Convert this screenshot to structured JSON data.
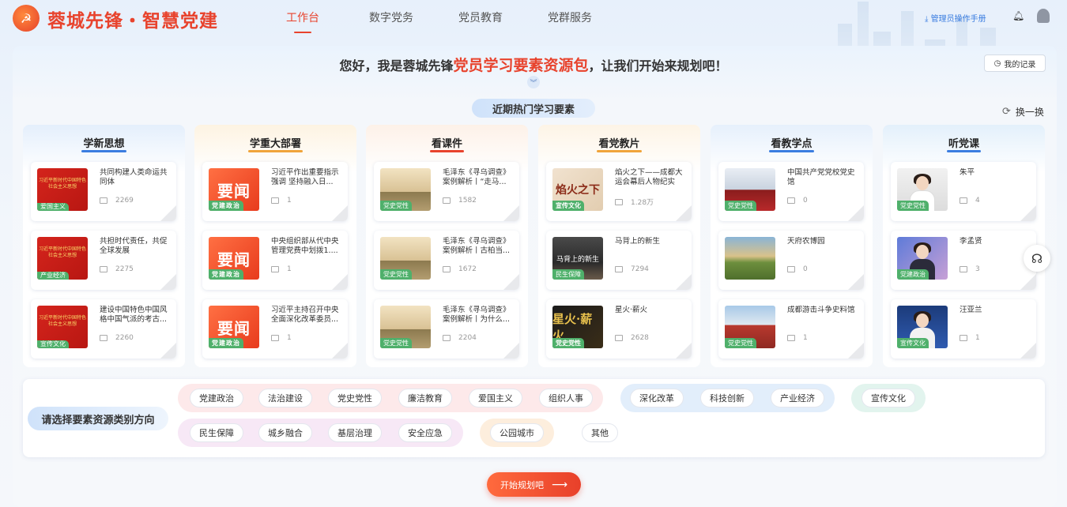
{
  "header": {
    "brand": "蓉城先锋・智慧党建",
    "nav": [
      "工作台",
      "数字党务",
      "党员教育",
      "党群服务"
    ],
    "active_nav": "工作台",
    "manual": "管理员操作手册"
  },
  "greeting": {
    "prefix": "您好，我是蓉城先锋",
    "highlight": "党员学习要素资源包",
    "suffix": "，让我们开始来规划吧！"
  },
  "records_label": "我的记录",
  "hot_title": "近期热门学习要素",
  "refresh_label": "换一换",
  "columns": [
    {
      "title": "学新思想",
      "accent": "#3b7de0",
      "items": [
        {
          "title": "共同构建人类命运共同体",
          "tag": "爱国主义",
          "views": "2269",
          "thumb": "习近平新时代中国特色社会主义思想"
        },
        {
          "title": "共担时代责任，共促全球发展",
          "tag": "产业经济",
          "views": "2275",
          "thumb": "习近平新时代中国特色社会主义思想"
        },
        {
          "title": "建设中国特色中国风格中国气派的考古...",
          "tag": "宣传文化",
          "views": "2260",
          "thumb": "习近平新时代中国特色社会主义思想"
        }
      ]
    },
    {
      "title": "学重大部署",
      "accent": "#f0a43a",
      "items": [
        {
          "title": "习近平作出重要指示强调 坚持融入日...",
          "tag": "党建政治",
          "views": "1",
          "thumb": "要闻"
        },
        {
          "title": "中央组织部从代中央管理党费中划拨1....",
          "tag": "党建政治",
          "views": "1",
          "thumb": "要闻"
        },
        {
          "title": "习近平主持召开中央全面深化改革委员...",
          "tag": "党建政治",
          "views": "1",
          "thumb": "要闻"
        }
      ]
    },
    {
      "title": "看课件",
      "accent": "#e8432d",
      "items": [
        {
          "title": "毛泽东《寻乌调查》案例解析丨“走马...",
          "tag": "党史党性",
          "views": "1582",
          "thumb": ""
        },
        {
          "title": "毛泽东《寻乌调查》案例解析丨古柏当...",
          "tag": "党史党性",
          "views": "1672",
          "thumb": ""
        },
        {
          "title": "毛泽东《寻乌调查》案例解析丨为什么...",
          "tag": "党史党性",
          "views": "2204",
          "thumb": ""
        }
      ]
    },
    {
      "title": "看党教片",
      "accent": "#f0a43a",
      "items": [
        {
          "title": "焰火之下——成都大运会幕后人物纪实",
          "tag": "宣传文化",
          "views": "1.28万",
          "thumb": "焰火之下"
        },
        {
          "title": "马背上的新生",
          "tag": "民生保障",
          "views": "7294",
          "thumb": "马背上的新生"
        },
        {
          "title": "星火·薪火",
          "tag": "党史党性",
          "views": "2628",
          "thumb": "星火·薪火"
        }
      ]
    },
    {
      "title": "看教学点",
      "accent": "#3b7de0",
      "items": [
        {
          "title": "中国共产党党校党史馆",
          "tag": "党史党性",
          "views": "0",
          "thumb": ""
        },
        {
          "title": "天府农博园",
          "tag": "",
          "views": "0",
          "thumb": ""
        },
        {
          "title": "成都游击斗争史料馆",
          "tag": "党史党性",
          "views": "1",
          "thumb": ""
        }
      ]
    },
    {
      "title": "听党课",
      "accent": "#3b7de0",
      "items": [
        {
          "title": "朱平",
          "tag": "党史党性",
          "views": "4",
          "thumb": ""
        },
        {
          "title": "李孟贤",
          "tag": "党建政治",
          "views": "3",
          "thumb": ""
        },
        {
          "title": "汪亚兰",
          "tag": "宣传文化",
          "views": "1",
          "thumb": ""
        }
      ]
    }
  ],
  "categories": {
    "prompt": "请选择要素资源类别方向",
    "row1_pink": [
      "党建政治",
      "法治建设",
      "党史党性",
      "廉洁教育",
      "爱国主义",
      "组织人事"
    ],
    "row1_blue": [
      "深化改革",
      "科技创新",
      "产业经济"
    ],
    "row1_green": [
      "宣传文化"
    ],
    "row2_purple": [
      "民生保障",
      "城乡融合",
      "基层治理",
      "安全应急"
    ],
    "row2_orange": [
      "公园城市"
    ],
    "row2_plain": [
      "其他"
    ]
  },
  "start_button": "开始规划吧",
  "colors": {
    "brand": "#e8432d",
    "accent_blue": "#3b7de0",
    "tag_green": "#4fb06b"
  }
}
